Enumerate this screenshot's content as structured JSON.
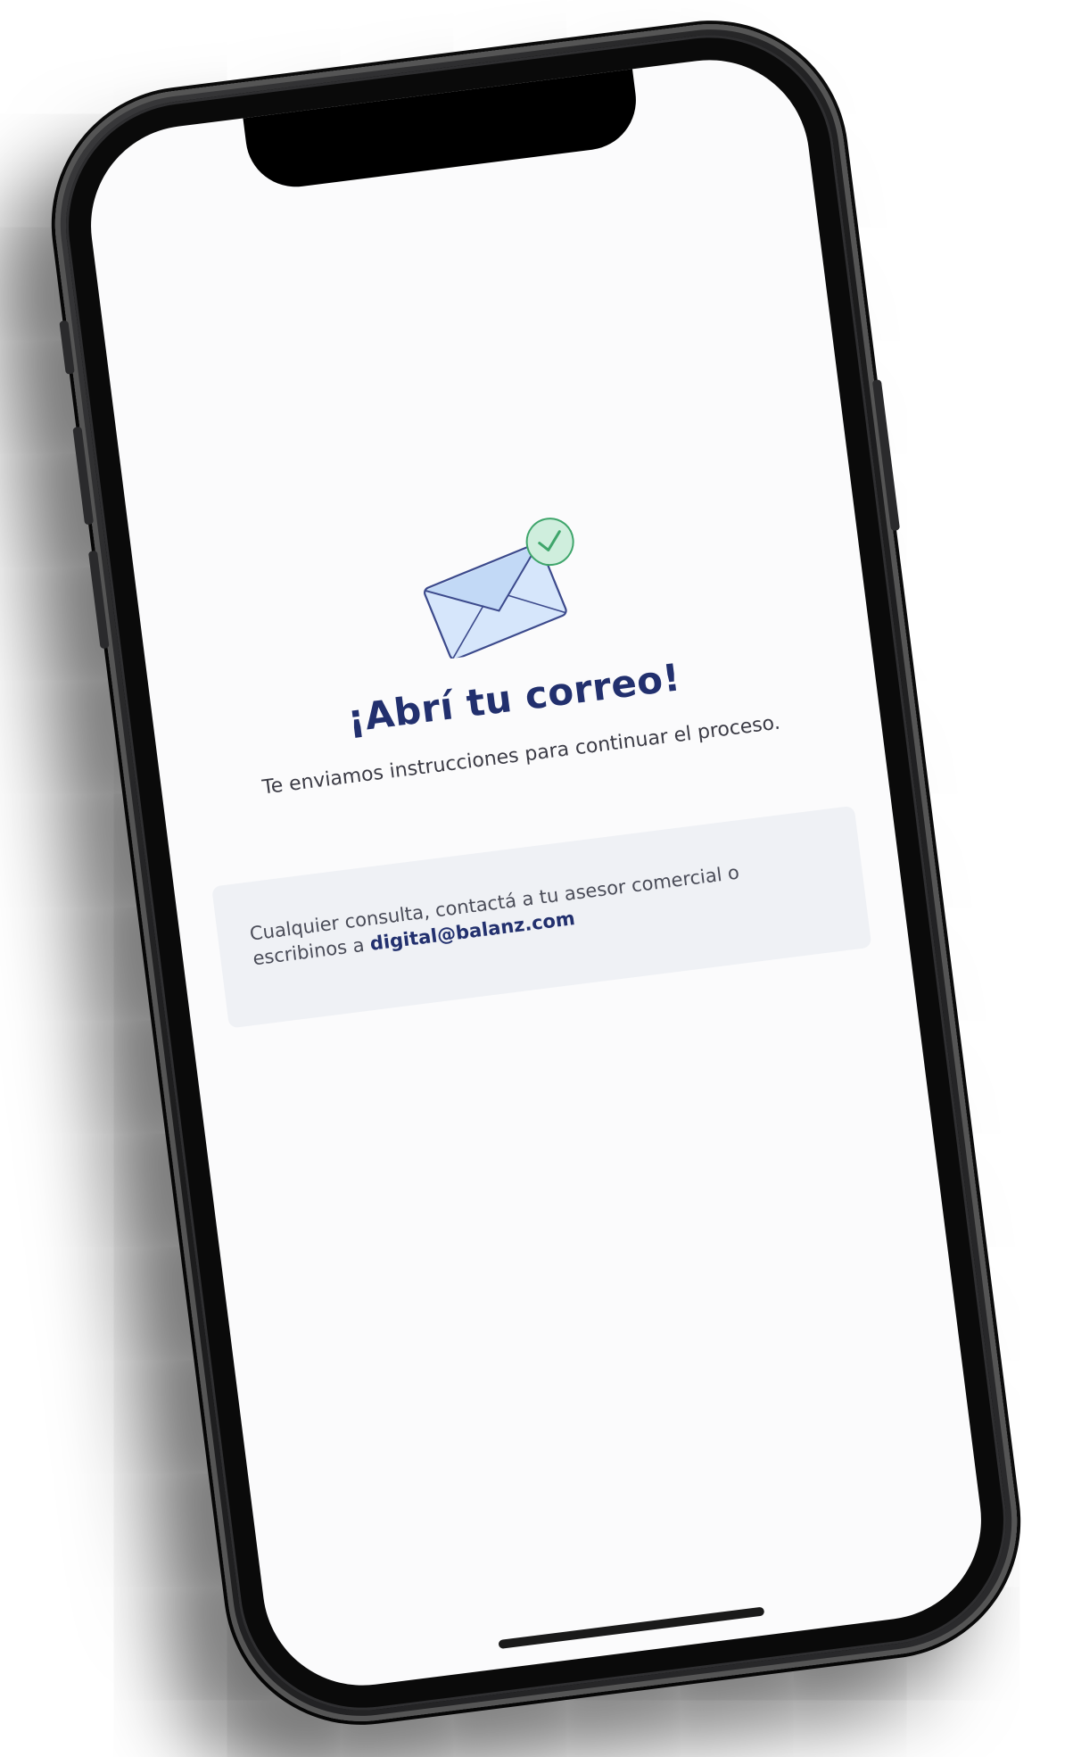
{
  "screen": {
    "title": "¡Abrí tu correo!",
    "subtitle": "Te enviamos instrucciones para continuar el proceso.",
    "icon": "envelope-check-icon",
    "info": {
      "text_before_link": "Cualquier consulta, contactá a tu asesor comercial o escribinos a ",
      "link_text": "digital@balanz.com"
    }
  },
  "colors": {
    "title": "#22306e",
    "envelope_fill": "#d6e6fb",
    "envelope_stroke": "#3c4a8c",
    "check_badge": "#cfeedd",
    "check_stroke": "#3fa56b",
    "info_box_bg": "#eff1f5"
  }
}
